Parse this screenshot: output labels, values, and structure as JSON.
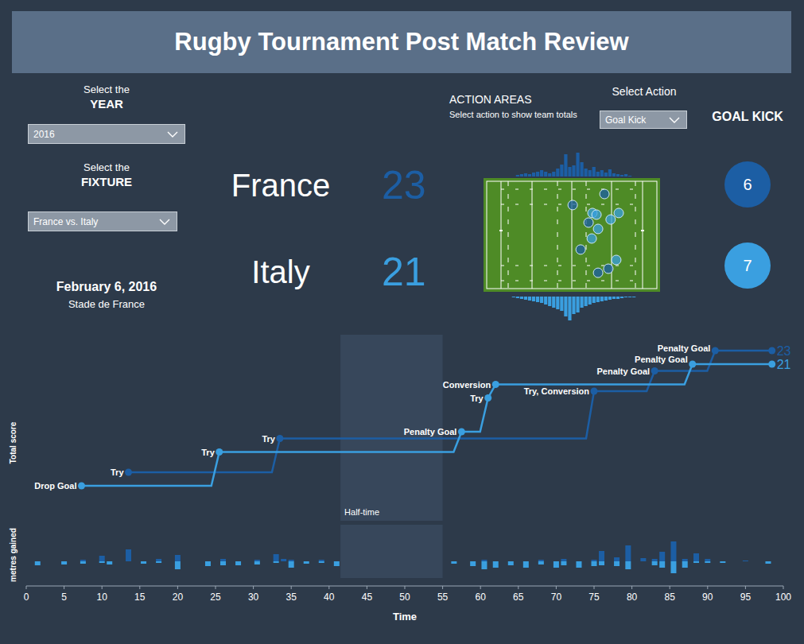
{
  "header": {
    "title": "Rugby Tournament Post Match Review"
  },
  "filters": [
    {
      "caption": "Select the",
      "label": "YEAR",
      "value": "2016"
    },
    {
      "caption": "Select the",
      "label": "FIXTURE",
      "value": "France vs. Italy"
    }
  ],
  "match": {
    "date": "February 6, 2016",
    "venue": "Stade de France"
  },
  "action_areas": {
    "title": "ACTION AREAS",
    "subtitle": "Select action to show team totals",
    "select_label": "Select Action",
    "selected_action": "Goal Kick",
    "action_title": "GOAL KICK"
  },
  "teams": [
    {
      "name": "France",
      "score": "23",
      "color": "#1c5ea4",
      "action_total": "6",
      "pitch_histogram": [
        0,
        0,
        0,
        0,
        0,
        0,
        0,
        0,
        2,
        3,
        4,
        3,
        5,
        6,
        8,
        6,
        4,
        6,
        10,
        15,
        28,
        12,
        14,
        30,
        18,
        10,
        8,
        12,
        6,
        8,
        5,
        9,
        4,
        3,
        2,
        3,
        1,
        0,
        0,
        0,
        0,
        0,
        0,
        0
      ],
      "pitch_dots": [
        {
          "x": 68.5,
          "y": 9.8
        },
        {
          "x": 50.5,
          "y": 16.6
        },
        {
          "x": 59.5,
          "y": 27.4
        },
        {
          "x": 55,
          "y": 44
        },
        {
          "x": 70.7,
          "y": 55.8
        },
        {
          "x": 64.9,
          "y": 58.3
        }
      ],
      "events": [
        {
          "time": 13.5,
          "score": 5,
          "label": "Try"
        },
        {
          "time": 33.5,
          "score": 10,
          "label": "Try"
        },
        {
          "time": 75,
          "score": 17,
          "label": "Try, Conversion"
        },
        {
          "time": 83,
          "score": 20,
          "label": "Penalty Goal"
        },
        {
          "time": 91,
          "score": 23,
          "label": "Penalty Goal"
        }
      ],
      "metres": [
        {
          "time": 7.5,
          "metres": 2
        },
        {
          "time": 10,
          "metres": 7
        },
        {
          "time": 13.5,
          "metres": 15
        },
        {
          "time": 17.5,
          "metres": 3
        },
        {
          "time": 20,
          "metres": 8
        },
        {
          "time": 26,
          "metres": 3
        },
        {
          "time": 30.5,
          "metres": 2
        },
        {
          "time": 33,
          "metres": 9
        },
        {
          "time": 34,
          "metres": 3
        },
        {
          "time": 35,
          "metres": 2
        },
        {
          "time": 39,
          "metres": 2
        },
        {
          "time": 60.5,
          "metres": 2
        },
        {
          "time": 68,
          "metres": 2
        },
        {
          "time": 71,
          "metres": 3
        },
        {
          "time": 75,
          "metres": 2
        },
        {
          "time": 76,
          "metres": 13
        },
        {
          "time": 78,
          "metres": 5
        },
        {
          "time": 79.5,
          "metres": 20
        },
        {
          "time": 81.5,
          "metres": 4
        },
        {
          "time": 83,
          "metres": 3
        },
        {
          "time": 84,
          "metres": 12
        },
        {
          "time": 85.5,
          "metres": 25
        },
        {
          "time": 87,
          "metres": 3
        },
        {
          "time": 88.5,
          "metres": 10
        },
        {
          "time": 90,
          "metres": 3
        },
        {
          "time": 95,
          "metres": 1
        }
      ]
    },
    {
      "name": "Italy",
      "score": "21",
      "color": "#3a9fe0",
      "action_total": "7",
      "pitch_histogram": [
        0,
        0,
        0,
        0,
        0,
        0,
        0,
        1,
        2,
        3,
        4,
        5,
        6,
        7,
        8,
        10,
        12,
        14,
        16,
        18,
        25,
        30,
        22,
        20,
        14,
        12,
        10,
        8,
        7,
        6,
        5,
        4,
        3,
        3,
        2,
        1,
        1,
        1,
        0,
        0,
        0,
        0,
        0,
        0
      ],
      "pitch_dots": [
        {
          "x": 61.7,
          "y": 21.5
        },
        {
          "x": 64,
          "y": 22.5
        },
        {
          "x": 76.6,
          "y": 21.5
        },
        {
          "x": 72,
          "y": 25.5
        },
        {
          "x": 64.9,
          "y": 31.3
        },
        {
          "x": 61.3,
          "y": 37.2
        },
        {
          "x": 75.2,
          "y": 50.4
        }
      ],
      "events": [
        {
          "time": 7.3,
          "score": 3,
          "label": "Drop Goal"
        },
        {
          "time": 25.5,
          "score": 8,
          "label": "Try"
        },
        {
          "time": 57.5,
          "score": 11,
          "label": "Penalty Goal"
        },
        {
          "time": 61,
          "score": 16,
          "label": "Try"
        },
        {
          "time": 62,
          "score": 18,
          "label": "Conversion"
        },
        {
          "time": 88,
          "score": 21,
          "label": "Penalty Goal"
        }
      ],
      "metres": [
        {
          "time": 1.5,
          "metres": 5
        },
        {
          "time": 5,
          "metres": 4
        },
        {
          "time": 7.5,
          "metres": 3
        },
        {
          "time": 10,
          "metres": 2
        },
        {
          "time": 11,
          "metres": 4
        },
        {
          "time": 15.5,
          "metres": 3
        },
        {
          "time": 17.5,
          "metres": 2
        },
        {
          "time": 20,
          "metres": 10
        },
        {
          "time": 24,
          "metres": 6
        },
        {
          "time": 26,
          "metres": 5
        },
        {
          "time": 28,
          "metres": 5
        },
        {
          "time": 30.5,
          "metres": 4
        },
        {
          "time": 33,
          "metres": 2
        },
        {
          "time": 35,
          "metres": 8
        },
        {
          "time": 37,
          "metres": 3
        },
        {
          "time": 39,
          "metres": 2
        },
        {
          "time": 41,
          "metres": 6
        },
        {
          "time": 56.5,
          "metres": 3
        },
        {
          "time": 59,
          "metres": 6
        },
        {
          "time": 60.5,
          "metres": 10
        },
        {
          "time": 62,
          "metres": 8
        },
        {
          "time": 64,
          "metres": 5
        },
        {
          "time": 66,
          "metres": 8
        },
        {
          "time": 68,
          "metres": 4
        },
        {
          "time": 70,
          "metres": 8
        },
        {
          "time": 71,
          "metres": 5
        },
        {
          "time": 73,
          "metres": 8
        },
        {
          "time": 75,
          "metres": 6
        },
        {
          "time": 76,
          "metres": 5
        },
        {
          "time": 78,
          "metres": 6
        },
        {
          "time": 79.5,
          "metres": 10
        },
        {
          "time": 83,
          "metres": 5
        },
        {
          "time": 84,
          "metres": 8
        },
        {
          "time": 85.5,
          "metres": 15
        },
        {
          "time": 87,
          "metres": 8
        },
        {
          "time": 88.5,
          "metres": 2
        },
        {
          "time": 90,
          "metres": 2
        },
        {
          "time": 92,
          "metres": 2
        },
        {
          "time": 98,
          "metres": 3
        }
      ]
    }
  ],
  "score_chart": {
    "y_label": "Total score",
    "end_time": 98.5,
    "half_time": {
      "label": "Half-time",
      "start": 41.5,
      "end": 55
    }
  },
  "metres_chart": {
    "y_label": "metres gained"
  },
  "x_axis": {
    "title": "Time",
    "ticks": [
      "0",
      "5",
      "10",
      "15",
      "20",
      "25",
      "30",
      "35",
      "40",
      "45",
      "50",
      "55",
      "60",
      "65",
      "70",
      "75",
      "80",
      "85",
      "90",
      "95",
      "100"
    ]
  }
}
